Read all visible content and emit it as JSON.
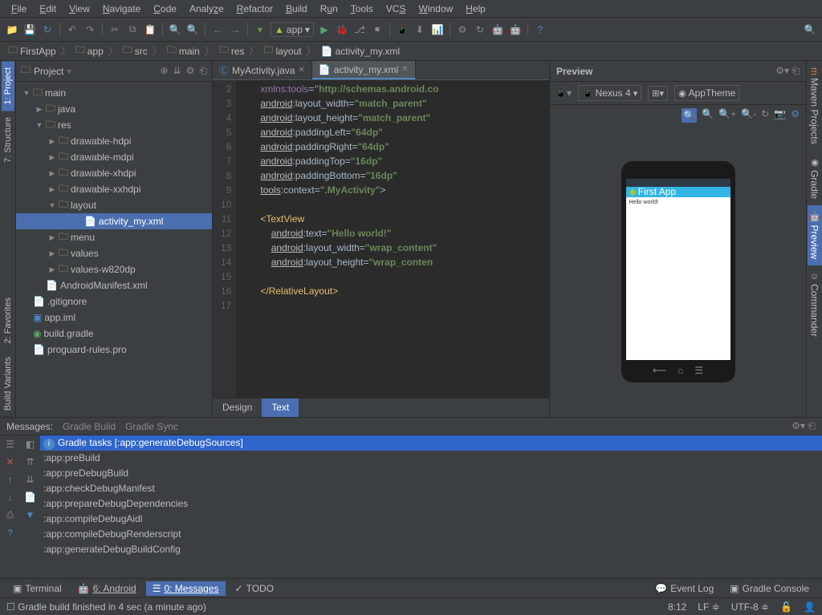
{
  "menu": [
    "File",
    "Edit",
    "View",
    "Navigate",
    "Code",
    "Analyze",
    "Refactor",
    "Build",
    "Run",
    "Tools",
    "VCS",
    "Window",
    "Help"
  ],
  "runConfig": "app",
  "breadcrumb": [
    "FirstApp",
    "app",
    "src",
    "main",
    "res",
    "layout",
    "activity_my.xml"
  ],
  "leftTabs": [
    "1: Project",
    "7: Structure",
    "2: Favorites",
    "Build Variants"
  ],
  "rightTabs": [
    "Maven Projects",
    "Gradle",
    "Preview",
    "Commander"
  ],
  "projectPanel": {
    "title": "Project"
  },
  "tree": {
    "items": [
      {
        "indent": 0,
        "caret": "▼",
        "icon": "folder",
        "label": "main"
      },
      {
        "indent": 1,
        "caret": "▶",
        "icon": "folder",
        "label": "java"
      },
      {
        "indent": 1,
        "caret": "▼",
        "icon": "folder",
        "label": "res"
      },
      {
        "indent": 2,
        "caret": "▶",
        "icon": "folder-r",
        "label": "drawable-hdpi"
      },
      {
        "indent": 2,
        "caret": "▶",
        "icon": "folder-r",
        "label": "drawable-mdpi"
      },
      {
        "indent": 2,
        "caret": "▶",
        "icon": "folder-r",
        "label": "drawable-xhdpi"
      },
      {
        "indent": 2,
        "caret": "▶",
        "icon": "folder-r",
        "label": "drawable-xxhdpi"
      },
      {
        "indent": 2,
        "caret": "▼",
        "icon": "folder-r",
        "label": "layout"
      },
      {
        "indent": 4,
        "caret": "",
        "icon": "xml",
        "label": "activity_my.xml",
        "selected": true
      },
      {
        "indent": 2,
        "caret": "▶",
        "icon": "folder-r",
        "label": "menu"
      },
      {
        "indent": 2,
        "caret": "▶",
        "icon": "folder-r",
        "label": "values"
      },
      {
        "indent": 2,
        "caret": "▶",
        "icon": "folder-r",
        "label": "values-w820dp"
      },
      {
        "indent": 1,
        "caret": "",
        "icon": "xml",
        "label": "AndroidManifest.xml"
      },
      {
        "indent": 0,
        "caret": "",
        "icon": "file",
        "label": ".gitignore"
      },
      {
        "indent": 0,
        "caret": "",
        "icon": "file-b",
        "label": "app.iml"
      },
      {
        "indent": 0,
        "caret": "",
        "icon": "gradle",
        "label": "build.gradle"
      },
      {
        "indent": 0,
        "caret": "",
        "icon": "file",
        "label": "proguard-rules.pro"
      }
    ]
  },
  "editorTabs": [
    {
      "icon": "class",
      "label": "MyActivity.java"
    },
    {
      "icon": "xml",
      "label": "activity_my.xml",
      "active": true
    }
  ],
  "lineNumbers": [
    2,
    3,
    4,
    5,
    6,
    7,
    8,
    9,
    10,
    11,
    12,
    13,
    14,
    15,
    16,
    17
  ],
  "editorBottomTabs": [
    "Design",
    "Text"
  ],
  "preview": {
    "title": "Preview",
    "device": "Nexus 4",
    "theme": "AppTheme",
    "appTitle": "First App",
    "content": "Hello world!"
  },
  "messagesPanel": {
    "tabs": [
      "Messages:",
      "Gradle Build",
      "Gradle Sync"
    ],
    "header": "Gradle tasks [:app:generateDebugSources]",
    "lines": [
      ":app:preBuild",
      ":app:preDebugBuild",
      ":app:checkDebugManifest",
      ":app:prepareDebugDependencies",
      ":app:compileDebugAidl",
      ":app:compileDebugRenderscript",
      ":app:generateDebugBuildConfig"
    ]
  },
  "bottomTabs": {
    "left": [
      "Terminal",
      "6: Android",
      "0: Messages",
      "TODO"
    ],
    "right": [
      "Event Log",
      "Gradle Console"
    ]
  },
  "status": {
    "msg": "Gradle build finished in 4 sec (a minute ago)",
    "pos": "8:12",
    "lineend": "LF",
    "enc": "UTF-8"
  }
}
